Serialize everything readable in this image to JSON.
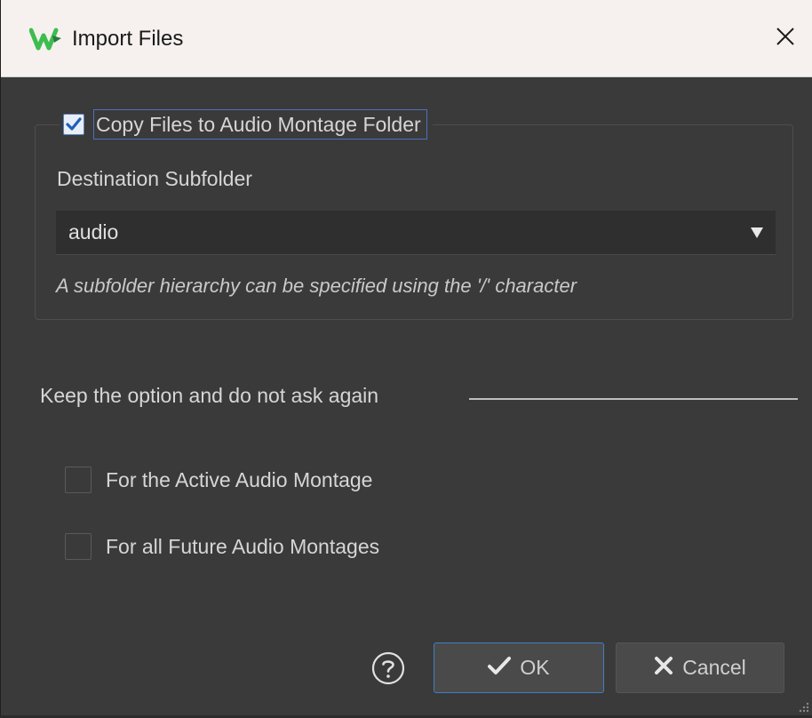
{
  "window": {
    "title": "Import Files"
  },
  "copy_group": {
    "checkbox_label": "Copy Files to Audio Montage Folder",
    "checked": true,
    "destination_label": "Destination Subfolder",
    "destination_value": "audio",
    "hint": "A subfolder hierarchy can be specified using the '/' character"
  },
  "keep_section": {
    "heading": "Keep the option and do not ask again",
    "options": [
      {
        "label": "For the Active Audio Montage",
        "checked": false
      },
      {
        "label": "For all Future Audio Montages",
        "checked": false
      }
    ]
  },
  "buttons": {
    "help_icon": "question-circle-icon",
    "ok_label": "OK",
    "cancel_label": "Cancel"
  },
  "colors": {
    "background": "#3a3a3a",
    "titlebar": "#f6f1ef",
    "accent_border": "#3f7fc4",
    "check_color": "#1f5fb8",
    "logo_green": "#3dbd4e"
  }
}
